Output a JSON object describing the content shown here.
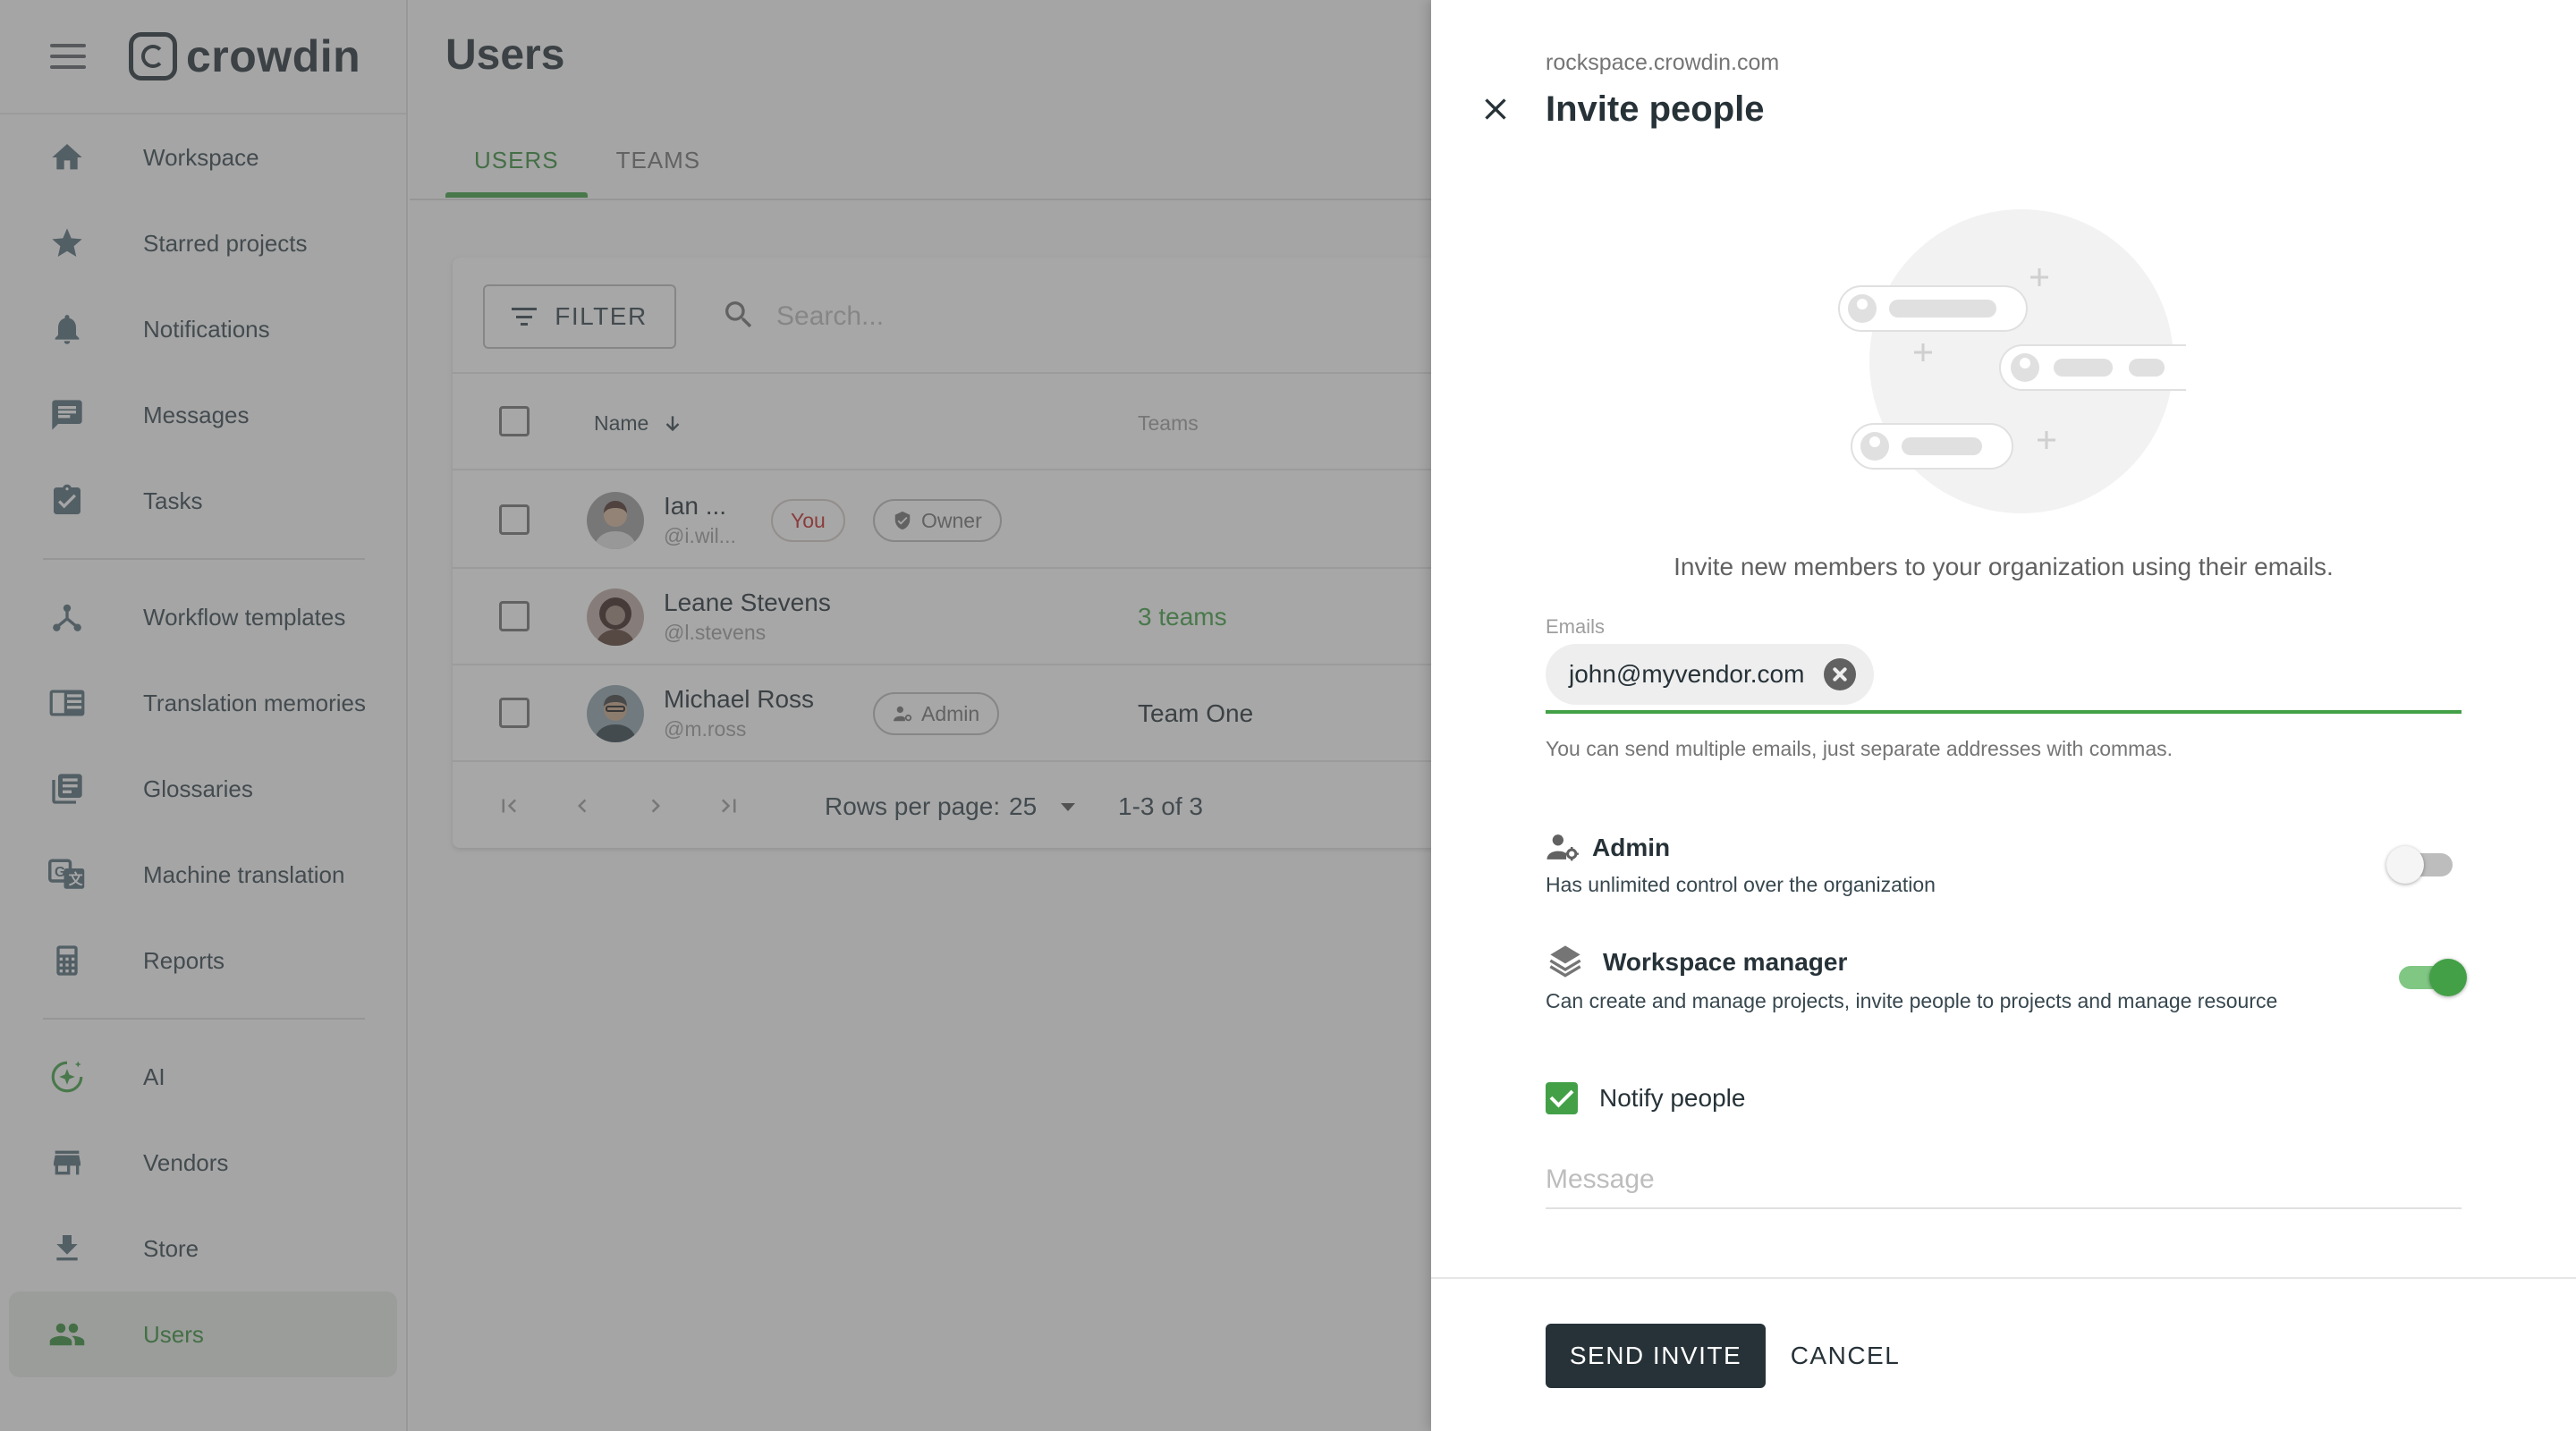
{
  "app": {
    "logo_text": "crowdin"
  },
  "sidebar": {
    "items": [
      {
        "label": "Workspace",
        "icon": "home-icon"
      },
      {
        "label": "Starred projects",
        "icon": "star-icon"
      },
      {
        "label": "Notifications",
        "icon": "bell-icon"
      },
      {
        "label": "Messages",
        "icon": "message-icon"
      },
      {
        "label": "Tasks",
        "icon": "clipboard-check-icon"
      },
      {
        "label": "Workflow templates",
        "icon": "workflow-icon"
      },
      {
        "label": "Translation memories",
        "icon": "book-open-icon"
      },
      {
        "label": "Glossaries",
        "icon": "library-icon"
      },
      {
        "label": "Machine translation",
        "icon": "translate-icon"
      },
      {
        "label": "Reports",
        "icon": "calculator-icon"
      },
      {
        "label": "AI",
        "icon": "ai-sparkle-icon"
      },
      {
        "label": "Vendors",
        "icon": "store-icon"
      },
      {
        "label": "Store",
        "icon": "download-icon"
      },
      {
        "label": "Users",
        "icon": "people-icon",
        "active": true
      }
    ]
  },
  "main": {
    "title": "Users",
    "tabs": [
      {
        "label": "USERS",
        "active": true
      },
      {
        "label": "TEAMS",
        "active": false
      }
    ],
    "filter_label": "FILTER",
    "search_placeholder": "Search...",
    "columns": {
      "name": "Name",
      "teams": "Teams"
    },
    "rows": [
      {
        "name": "Ian ...",
        "handle": "@i.wil...",
        "badges": [
          "You",
          "Owner"
        ],
        "teams": ""
      },
      {
        "name": "Leane Stevens",
        "handle": "@l.stevens",
        "badges": [],
        "teams": "3 teams"
      },
      {
        "name": "Michael Ross",
        "handle": "@m.ross",
        "badges": [
          "Admin"
        ],
        "teams": "Team One"
      }
    ],
    "pagination": {
      "rows_per_page_label": "Rows per page:",
      "rows_per_page": "25",
      "range": "1-3 of 3"
    }
  },
  "dialog": {
    "domain": "rockspace.crowdin.com",
    "title": "Invite people",
    "intro": "Invite new members to your organization using their emails.",
    "emails_label": "Emails",
    "emails": [
      "john@myvendor.com"
    ],
    "helper": "You can send multiple emails, just separate addresses with commas.",
    "options": [
      {
        "title": "Admin",
        "desc": "Has unlimited control over the organization",
        "enabled": false
      },
      {
        "title": "Workspace manager",
        "desc": "Can create and manage projects, invite people to projects and manage resource",
        "enabled": true
      }
    ],
    "notify_label": "Notify people",
    "notify_checked": true,
    "message_placeholder": "Message",
    "send_label": "SEND INVITE",
    "cancel_label": "CANCEL"
  },
  "colors": {
    "accent": "#43a047",
    "dark": "#263238",
    "you_badge": "#c62828"
  }
}
